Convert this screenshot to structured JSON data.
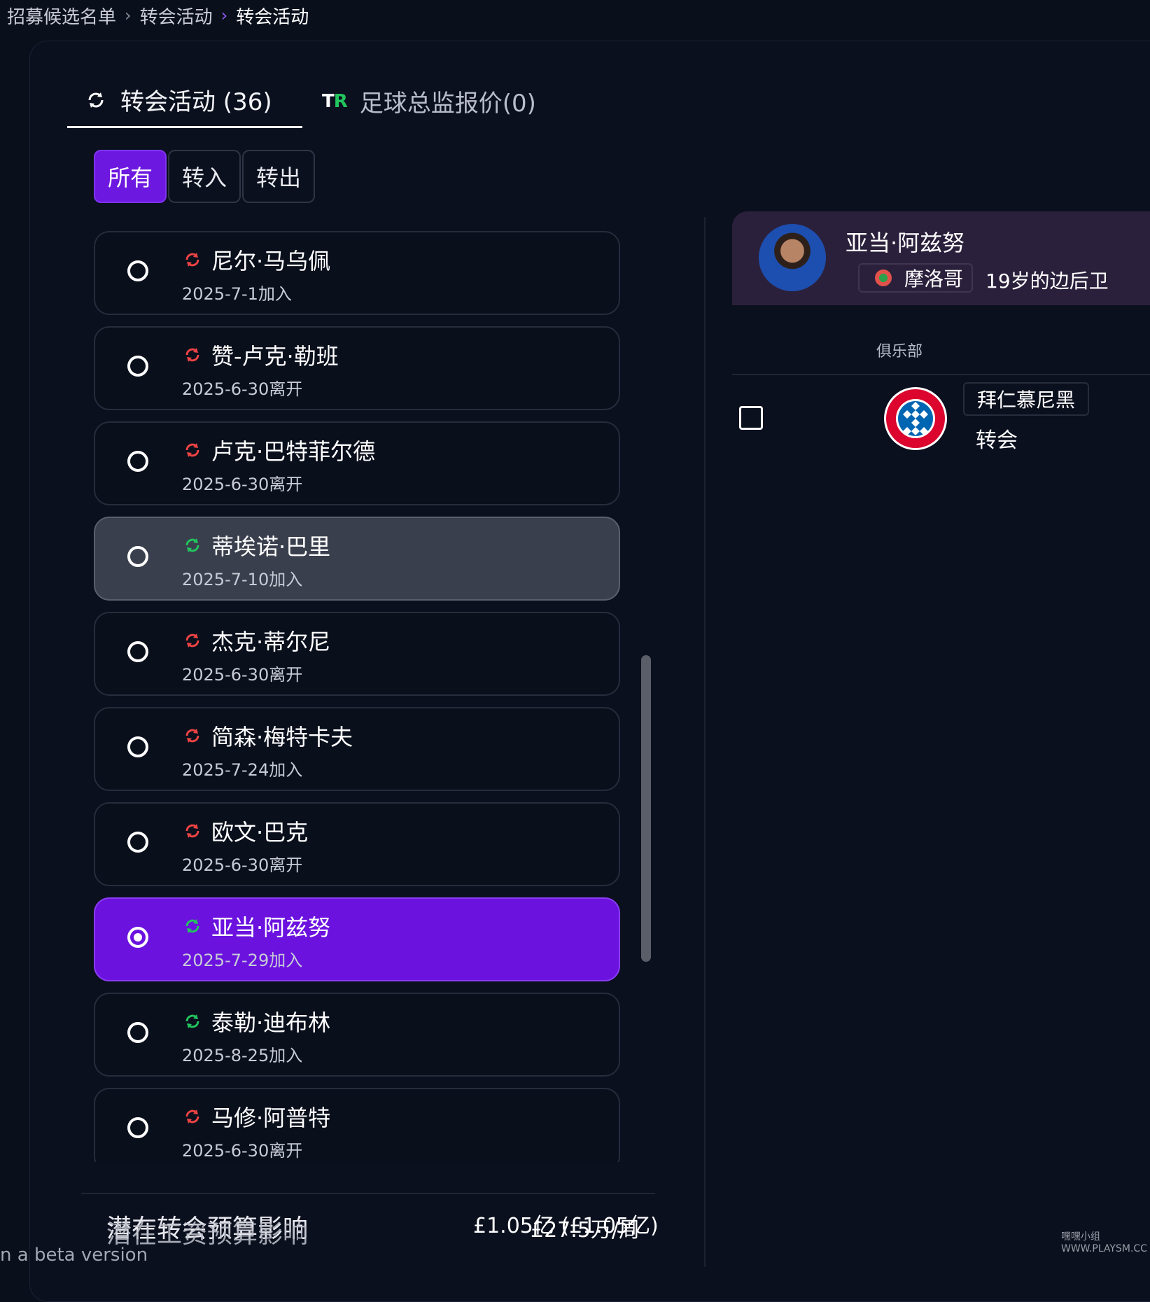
{
  "breadcrumb": {
    "item1": "招募候选名单",
    "item2": "转会活动",
    "current": "转会活动"
  },
  "tabs": {
    "transfer_activity": "转会活动 (36)",
    "director_offers": "足球总监报价(0)",
    "tr_logo_t": "T",
    "tr_logo_r": "R"
  },
  "filters": {
    "all": "所有",
    "in": "转入",
    "out": "转出"
  },
  "players": [
    {
      "name": "尼尔·马乌佩",
      "date": "2025-7-1加入",
      "icon_color": "#ef4444",
      "state": "normal"
    },
    {
      "name": "赞-卢克·勒班",
      "date": "2025-6-30离开",
      "icon_color": "#ef4444",
      "state": "normal"
    },
    {
      "name": "卢克·巴特菲尔德",
      "date": "2025-6-30离开",
      "icon_color": "#ef4444",
      "state": "normal"
    },
    {
      "name": "蒂埃诺·巴里",
      "date": "2025-7-10加入",
      "icon_color": "#22c55e",
      "state": "hover"
    },
    {
      "name": "杰克·蒂尔尼",
      "date": "2025-6-30离开",
      "icon_color": "#ef4444",
      "state": "normal"
    },
    {
      "name": "简森·梅特卡夫",
      "date": "2025-7-24加入",
      "icon_color": "#ef4444",
      "state": "normal"
    },
    {
      "name": "欧文·巴克",
      "date": "2025-6-30离开",
      "icon_color": "#ef4444",
      "state": "normal"
    },
    {
      "name": "亚当·阿兹努",
      "date": "2025-7-29加入",
      "icon_color": "#22c55e",
      "state": "selected"
    },
    {
      "name": "泰勒·迪布林",
      "date": "2025-8-25加入",
      "icon_color": "#22c55e",
      "state": "normal"
    },
    {
      "name": "马修·阿普特",
      "date": "2025-6-30离开",
      "icon_color": "#ef4444",
      "state": "normal"
    }
  ],
  "footer": {
    "label_transfer": "潜在转会预算影响",
    "label_wage": "潜在工资预算影响",
    "value_transfer": "£1.05亿 (£1.05亿)",
    "value_wage": "£27.5万/周",
    "beta": "n a beta version"
  },
  "detail": {
    "player_name": "亚当·阿兹努",
    "nation": "摩洛哥",
    "description": "19岁的边后卫",
    "club_header": "俱乐部",
    "club_name": "拜仁慕尼黑",
    "club_status": "转会",
    "club_logo_text": "FC BAYERN MÜNCHEN"
  },
  "watermark": "嘿嘿小组 WWW.PLAYSM.CC",
  "colors": {
    "accent": "#6d18e0",
    "in_icon": "#22c55e",
    "out_icon": "#ef4444"
  }
}
